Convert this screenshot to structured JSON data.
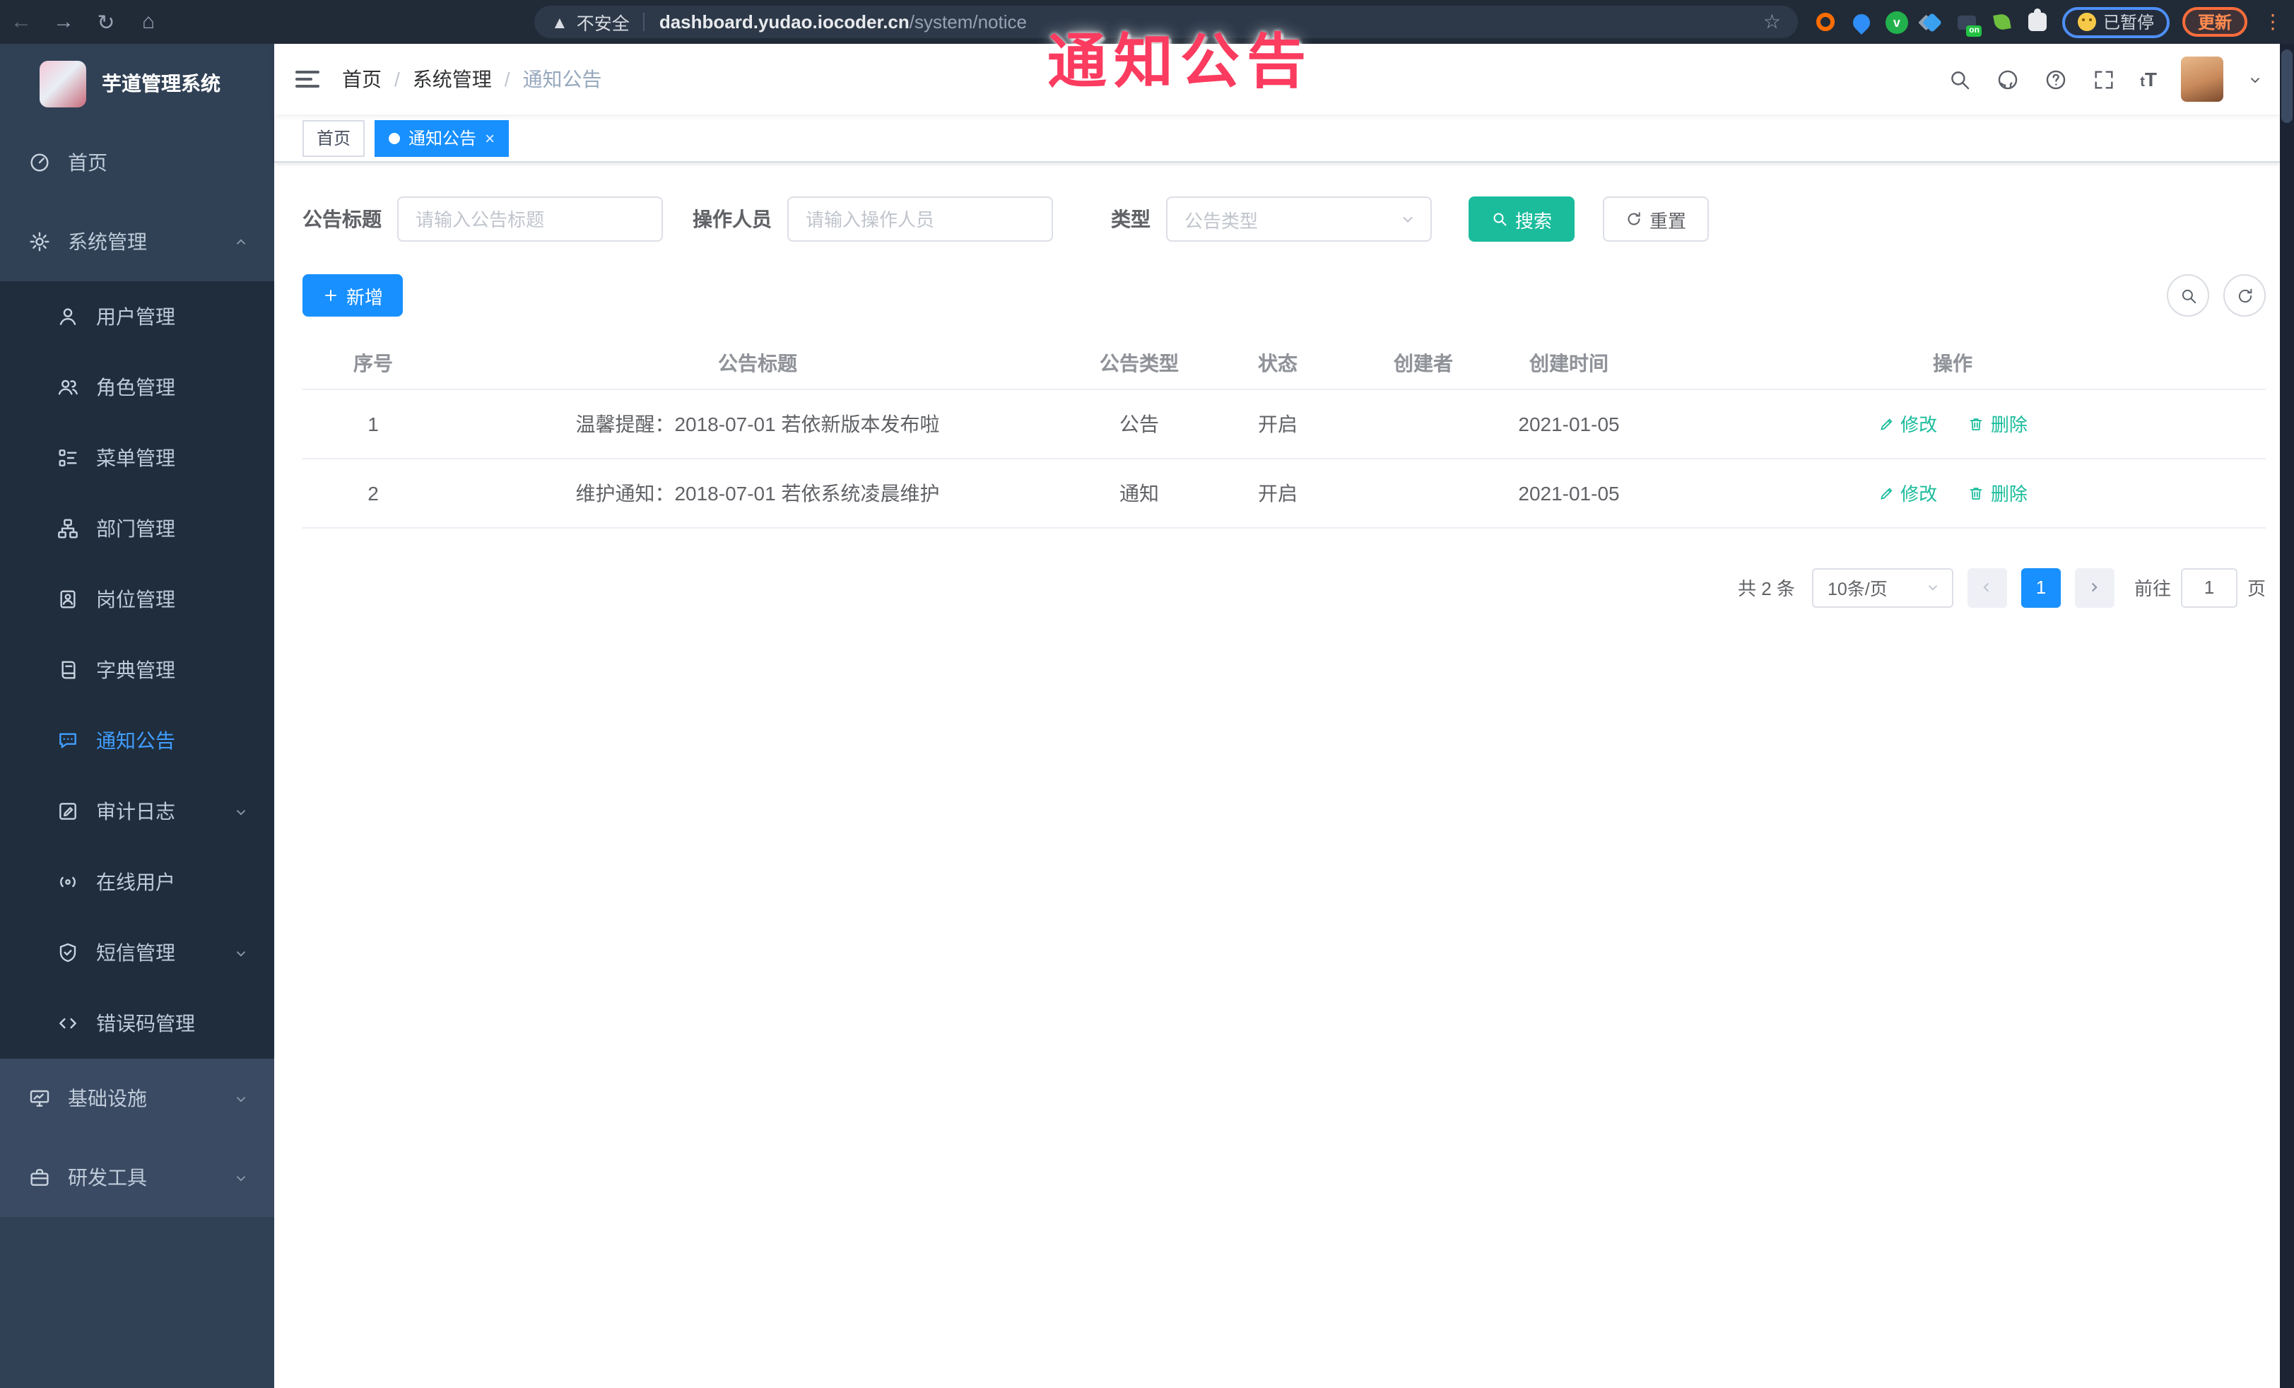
{
  "overlay": {
    "title": "通知公告"
  },
  "colors": {
    "accent_blue": "#1890ff",
    "sidebar_active_blue": "#409eff",
    "teal": "#1abc9c",
    "overlay_red": "#fb3b5f",
    "sidebar_bg": "#304156",
    "submenu_bg": "#1f2d3d",
    "chrome_bg": "#212b38",
    "update_orange": "#ff6d3b",
    "paused_ring_blue": "#4f8ff7"
  },
  "browser": {
    "security_label": "不安全",
    "url_host": "dashboard.yudao.iocoder.cn",
    "url_path": "/system/notice",
    "ext_on_badge": "on",
    "paused_label": "已暂停",
    "update_label": "更新"
  },
  "sidebar": {
    "app_title": "芋道管理系统",
    "items": [
      {
        "label": "首页",
        "icon": "dashboard-icon",
        "level": 1
      },
      {
        "label": "系统管理",
        "icon": "gear-icon",
        "level": 1,
        "expanded": true
      },
      {
        "label": "用户管理",
        "icon": "user-icon",
        "level": 2
      },
      {
        "label": "角色管理",
        "icon": "roles-icon",
        "level": 2
      },
      {
        "label": "菜单管理",
        "icon": "menu-tree-icon",
        "level": 2
      },
      {
        "label": "部门管理",
        "icon": "org-chart-icon",
        "level": 2
      },
      {
        "label": "岗位管理",
        "icon": "id-badge-icon",
        "level": 2
      },
      {
        "label": "字典管理",
        "icon": "book-icon",
        "level": 2
      },
      {
        "label": "通知公告",
        "icon": "message-icon",
        "level": 2,
        "active": true
      },
      {
        "label": "审计日志",
        "icon": "audit-log-icon",
        "level": 2,
        "collapsed": true
      },
      {
        "label": "在线用户",
        "icon": "online-icon",
        "level": 2
      },
      {
        "label": "短信管理",
        "icon": "shield-icon",
        "level": 2,
        "collapsed": true
      },
      {
        "label": "错误码管理",
        "icon": "code-icon",
        "level": 2
      },
      {
        "label": "基础设施",
        "icon": "monitor-icon",
        "level": 1,
        "collapsed": true
      },
      {
        "label": "研发工具",
        "icon": "toolbox-icon",
        "level": 1,
        "collapsed": true
      }
    ]
  },
  "header": {
    "breadcrumb": [
      "首页",
      "系统管理",
      "通知公告"
    ],
    "font_size_icon_label": "tT"
  },
  "tags": [
    {
      "label": "首页",
      "active": false
    },
    {
      "label": "通知公告",
      "active": true,
      "closable": true
    }
  ],
  "filters": {
    "title_label": "公告标题",
    "title_placeholder": "请输入公告标题",
    "operator_label": "操作人员",
    "operator_placeholder": "请输入操作人员",
    "type_label": "类型",
    "type_placeholder": "公告类型",
    "search_label": "搜索",
    "reset_label": "重置"
  },
  "toolbar": {
    "add_label": "新增"
  },
  "table": {
    "columns": [
      "序号",
      "公告标题",
      "公告类型",
      "状态",
      "创建者",
      "创建时间",
      "操作"
    ],
    "rows": [
      {
        "index": "1",
        "title": "温馨提醒：2018-07-01 若依新版本发布啦",
        "type": "公告",
        "status": "开启",
        "creator": "",
        "created_at": "2021-01-05",
        "edit_label": "修改",
        "delete_label": "删除"
      },
      {
        "index": "2",
        "title": "维护通知：2018-07-01 若依系统凌晨维护",
        "type": "通知",
        "status": "开启",
        "creator": "",
        "created_at": "2021-01-05",
        "edit_label": "修改",
        "delete_label": "删除"
      }
    ]
  },
  "pagination": {
    "total_label": "共 2 条",
    "page_size": "10条/页",
    "current_page": "1",
    "goto_label": "前往",
    "goto_value": "1",
    "page_suffix": "页"
  }
}
